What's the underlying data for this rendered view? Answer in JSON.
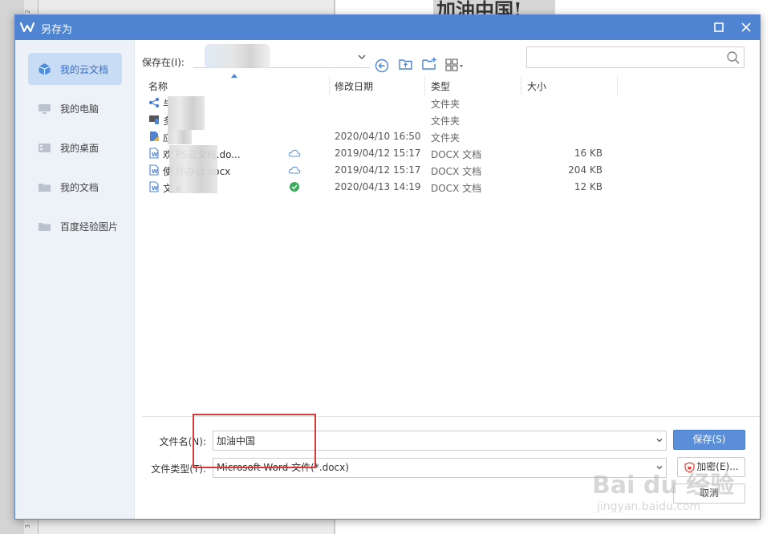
{
  "background": {
    "heading_text": "加油中国!",
    "ruler_marks": [
      "2",
      "3"
    ]
  },
  "dialog": {
    "title": "另存为",
    "accent_color": "#4f84d3"
  },
  "sidebar": {
    "items": [
      {
        "label": "我的云文档",
        "icon": "cloud-doc-icon",
        "active": true
      },
      {
        "label": "我的电脑",
        "icon": "computer-icon",
        "active": false
      },
      {
        "label": "我的桌面",
        "icon": "desktop-icon",
        "active": false
      },
      {
        "label": "我的文档",
        "icon": "folder-icon",
        "active": false
      },
      {
        "label": "百度经验图片",
        "icon": "folder-icon",
        "active": false
      }
    ]
  },
  "toolbar": {
    "save_in_label": "保存在(I):",
    "path_value": "",
    "search_placeholder": ""
  },
  "columns": {
    "name": "名称",
    "modified": "修改日期",
    "type": "类型",
    "size": "大小"
  },
  "files": [
    {
      "name": "与",
      "date": "",
      "type": "文件夹",
      "size": "",
      "icon": "share-folder-icon",
      "status": ""
    },
    {
      "name": "多",
      "date": "",
      "type": "文件夹",
      "size": "",
      "icon": "device-folder-icon",
      "status": ""
    },
    {
      "name": "应",
      "date": "2020/04/10 16:50",
      "type": "文件夹",
      "size": "",
      "icon": "app-folder-icon",
      "status": ""
    },
    {
      "name": "欢           PS云文档.do...",
      "date": "2019/04/12 15:17",
      "type": "DOCX 文档",
      "size": "16 KB",
      "icon": "word-doc-icon",
      "status": "cloud-icon"
    },
    {
      "name": "使            作办公.docx",
      "date": "2019/04/12 15:17",
      "type": "DOCX 文档",
      "size": "204 KB",
      "icon": "word-doc-icon",
      "status": "cloud-icon"
    },
    {
      "name": "文                x",
      "date": "2020/04/13 14:19",
      "type": "DOCX 文档",
      "size": "12 KB",
      "icon": "word-doc-icon",
      "status": "synced-check-icon"
    }
  ],
  "form": {
    "filename_label": "文件名(N):",
    "filename_value": "加油中国",
    "filetype_label": "文件类型(T):",
    "filetype_value": "Microsoft Word 文件(*.docx)"
  },
  "buttons": {
    "save": "保存(S)",
    "encrypt": "加密(E)...",
    "cancel": "取消"
  },
  "watermark": {
    "brand": "Bai du 经验",
    "url": "jingyan.baidu.com"
  }
}
